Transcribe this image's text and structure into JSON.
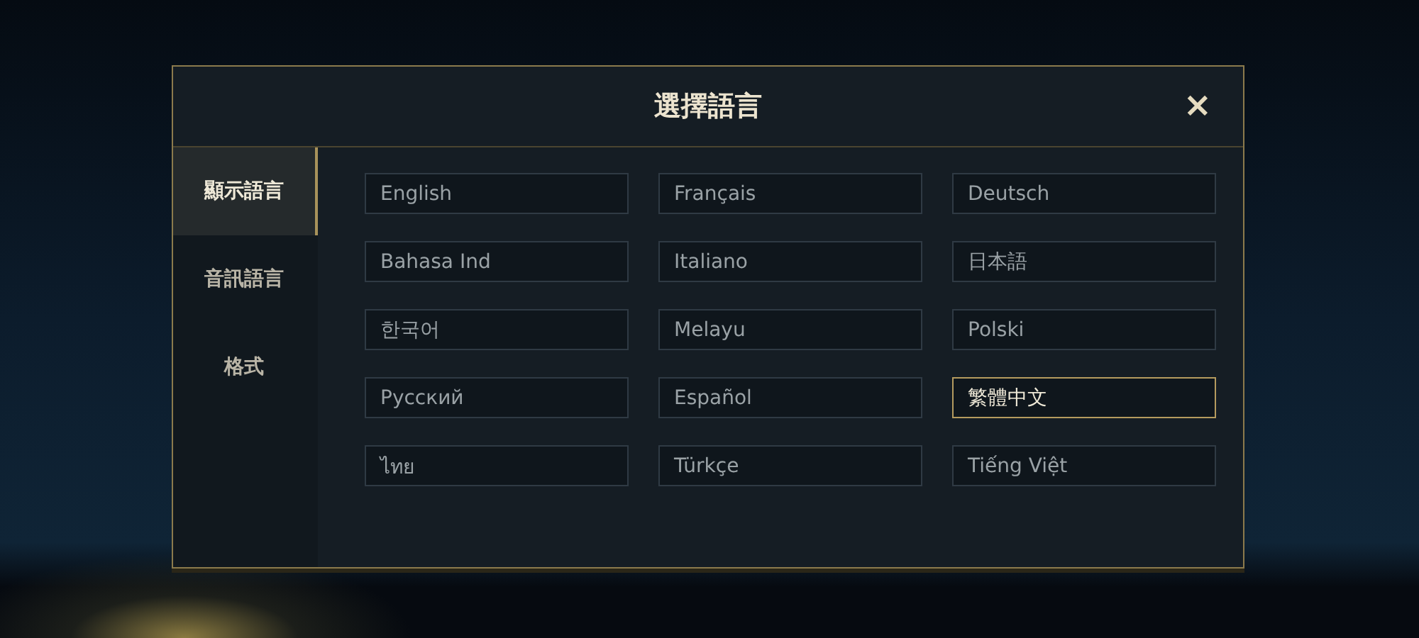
{
  "dialog": {
    "title": "選擇語言",
    "close": "×"
  },
  "sidebar": {
    "items": [
      {
        "label": "顯示語言",
        "selected": true
      },
      {
        "label": "音訊語言",
        "selected": false
      },
      {
        "label": "格式",
        "selected": false
      }
    ]
  },
  "languages": [
    {
      "label": "English",
      "selected": false
    },
    {
      "label": "Français",
      "selected": false
    },
    {
      "label": "Deutsch",
      "selected": false
    },
    {
      "label": "Bahasa Ind",
      "selected": false
    },
    {
      "label": "Italiano",
      "selected": false
    },
    {
      "label": "日本語",
      "selected": false
    },
    {
      "label": "한국어",
      "selected": false
    },
    {
      "label": "Melayu",
      "selected": false
    },
    {
      "label": "Polski",
      "selected": false
    },
    {
      "label": "Русский",
      "selected": false
    },
    {
      "label": "Español",
      "selected": false
    },
    {
      "label": "繁體中文",
      "selected": true
    },
    {
      "label": "ไทย",
      "selected": false
    },
    {
      "label": "Türkçe",
      "selected": false
    },
    {
      "label": "Tiếng Việt",
      "selected": false
    }
  ]
}
